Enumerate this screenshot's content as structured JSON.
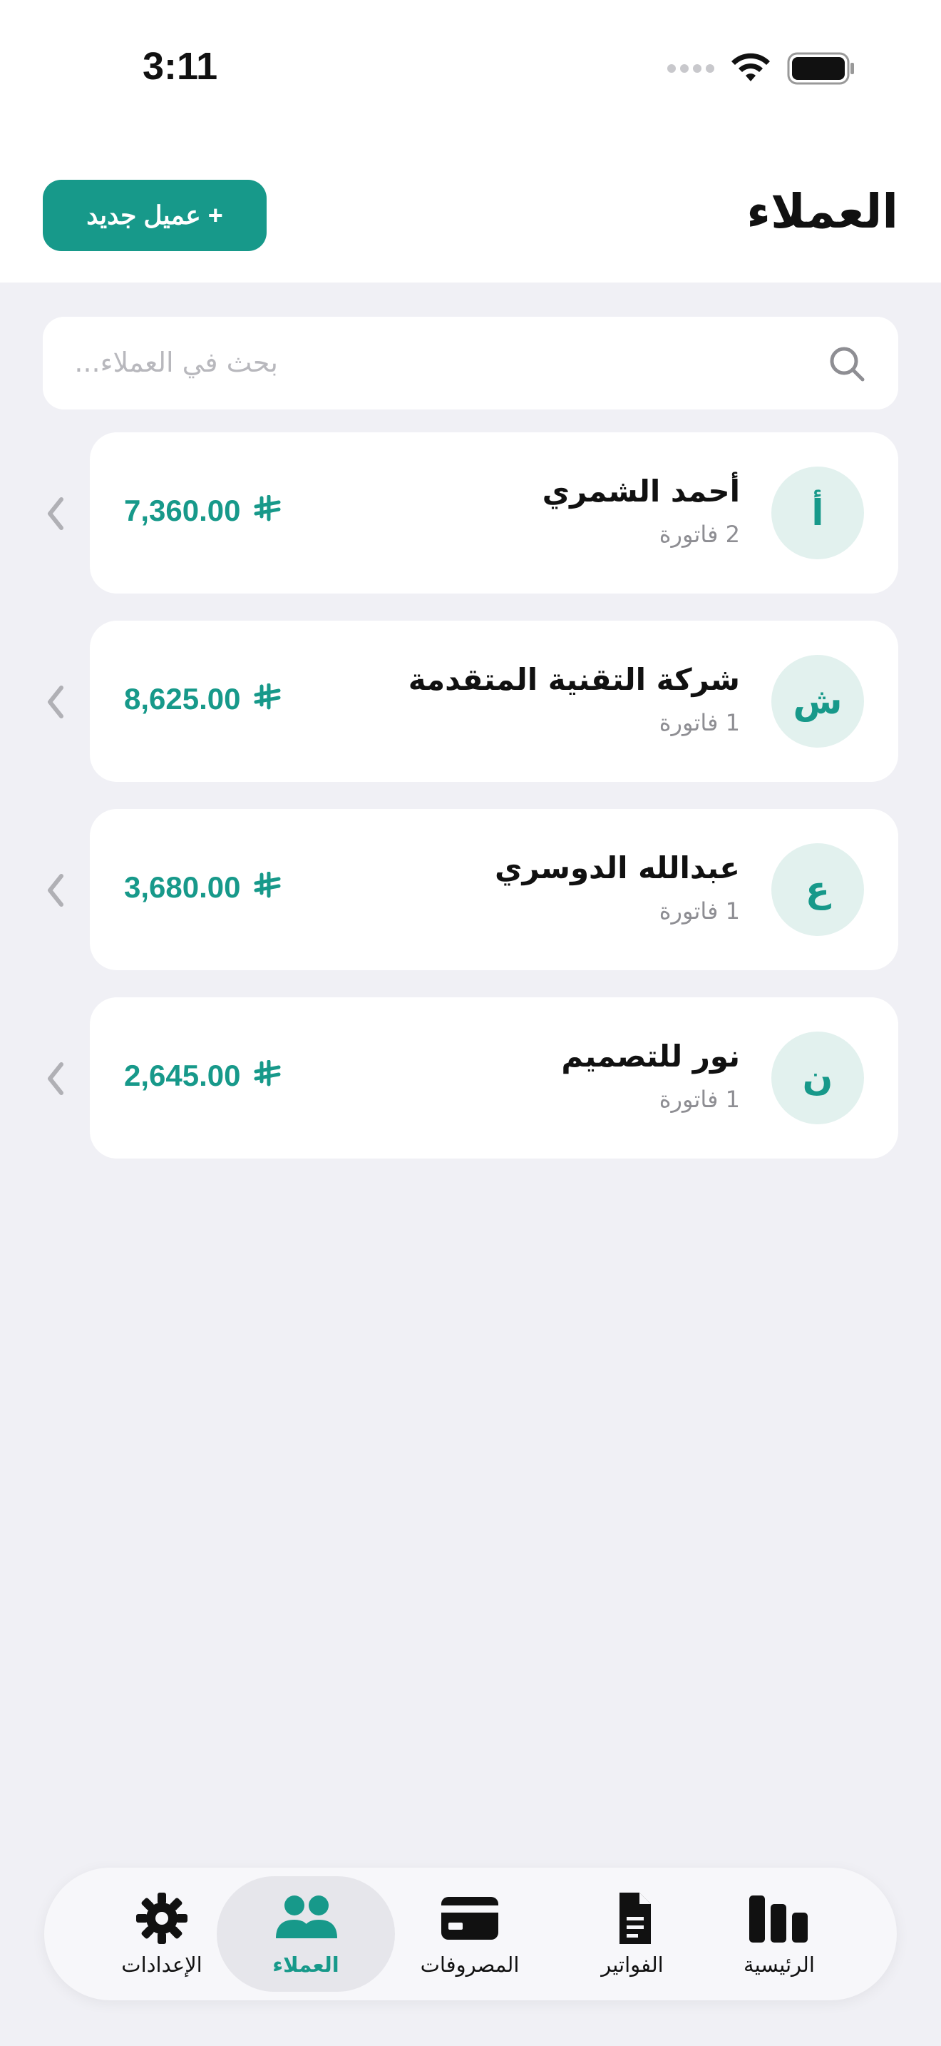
{
  "status_bar": {
    "time": "3:11",
    "icons": [
      "signal-icon",
      "wifi-icon",
      "battery-icon"
    ]
  },
  "header": {
    "title": "العملاء",
    "new_client_label": "+ عميل جديد"
  },
  "search": {
    "placeholder": "بحث في العملاء..."
  },
  "clients": [
    {
      "initial": "أ",
      "name": "أحمد الشمري",
      "invoices": "2 فاتورة",
      "amount": "7,360.00"
    },
    {
      "initial": "ش",
      "name": "شركة التقنية المتقدمة",
      "invoices": "1 فاتورة",
      "amount": "8,625.00"
    },
    {
      "initial": "ع",
      "name": "عبدالله الدوسري",
      "invoices": "1 فاتورة",
      "amount": "3,680.00"
    },
    {
      "initial": "ن",
      "name": "نور للتصميم",
      "invoices": "1 فاتورة",
      "amount": "2,645.00"
    }
  ],
  "currency_icon": "riyal-icon",
  "tabs": [
    {
      "label": "الرئيسية",
      "icon": "chart-bars-icon",
      "active": false
    },
    {
      "label": "الفواتير",
      "icon": "document-icon",
      "active": false
    },
    {
      "label": "المصروفات",
      "icon": "card-icon",
      "active": false
    },
    {
      "label": "العملاء",
      "icon": "people-icon",
      "active": true
    },
    {
      "label": "الإعدادات",
      "icon": "gear-icon",
      "active": false
    }
  ],
  "colors": {
    "accent": "#17998a",
    "avatar_bg": "#e2f1ee",
    "background": "#f0f0f5"
  }
}
